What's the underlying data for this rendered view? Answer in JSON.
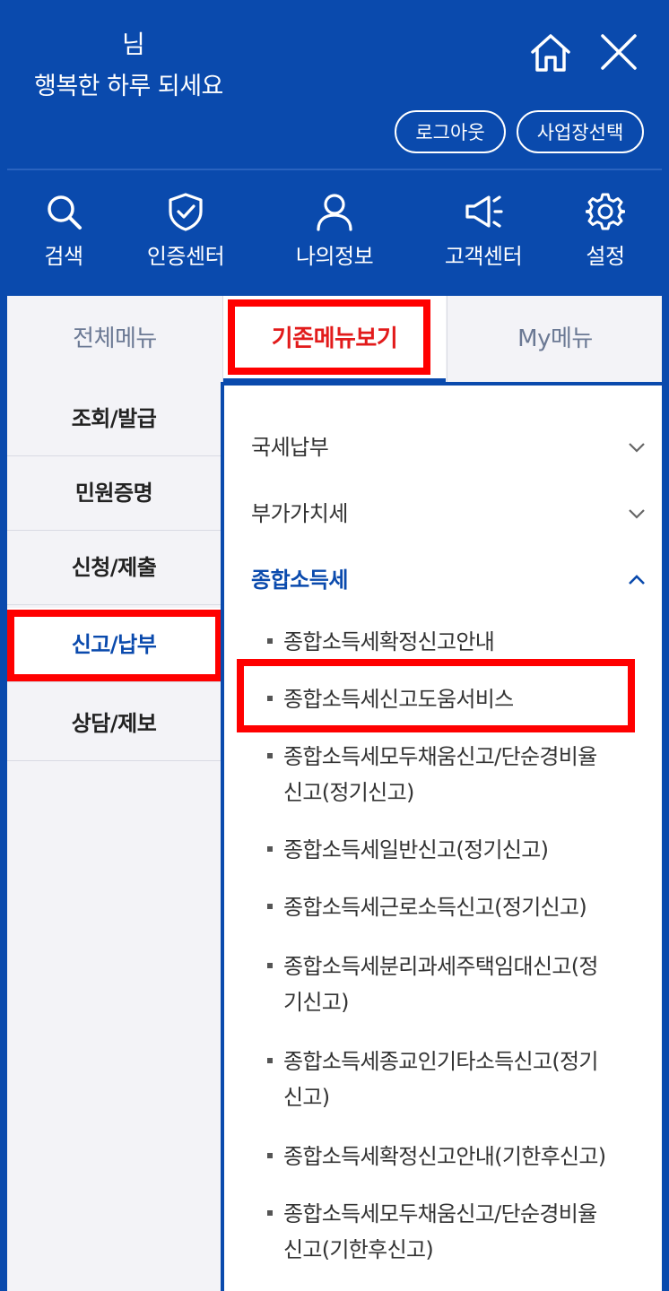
{
  "header": {
    "greeting_suffix": "님",
    "greeting_line2": "행복한 하루 되세요",
    "home_icon": "home-icon",
    "close_icon": "close-icon",
    "logout_label": "로그아웃",
    "business_select_label": "사업장선택"
  },
  "quick_menu": [
    {
      "label": "검색",
      "icon": "search-icon"
    },
    {
      "label": "인증센터",
      "icon": "shield-check-icon"
    },
    {
      "label": "나의정보",
      "icon": "user-icon"
    },
    {
      "label": "고객센터",
      "icon": "megaphone-icon"
    },
    {
      "label": "설정",
      "icon": "gear-icon"
    }
  ],
  "tabs": [
    {
      "label": "전체메뉴",
      "active": false
    },
    {
      "label": "기존메뉴보기",
      "active": true
    },
    {
      "label": "My메뉴",
      "active": false
    }
  ],
  "left_nav": [
    {
      "label": "조회/발급",
      "active": false
    },
    {
      "label": "민원증명",
      "active": false
    },
    {
      "label": "신청/제출",
      "active": false
    },
    {
      "label": "신고/납부",
      "active": true
    },
    {
      "label": "상담/제보",
      "active": false
    }
  ],
  "categories": [
    {
      "label": "국세납부",
      "expanded": false
    },
    {
      "label": "부가가치세",
      "expanded": false
    },
    {
      "label": "종합소득세",
      "expanded": true
    }
  ],
  "sub_items": [
    {
      "line1": "종합소득세확정신고안내",
      "line2": ""
    },
    {
      "line1": "종합소득세신고도움서비스",
      "line2": ""
    },
    {
      "line1": "종합소득세모두채움신고/단순경비율",
      "line2": "신고(정기신고)"
    },
    {
      "line1": "종합소득세일반신고(정기신고)",
      "line2": ""
    },
    {
      "line1": "종합소득세근로소득신고(정기신고)",
      "line2": ""
    },
    {
      "line1": "종합소득세분리과세주택임대신고(정",
      "line2": "기신고)"
    },
    {
      "line1": "종합소득세종교인기타소득신고(정기",
      "line2": "신고)"
    },
    {
      "line1": "종합소득세확정신고안내(기한후신고)",
      "line2": ""
    },
    {
      "line1": "종합소득세모두채움신고/단순경비율",
      "line2": "신고(기한후신고)"
    }
  ],
  "colors": {
    "brand_blue": "#0a4aad",
    "highlight_red": "#ff0000",
    "active_tab_text": "#e21b1b"
  }
}
